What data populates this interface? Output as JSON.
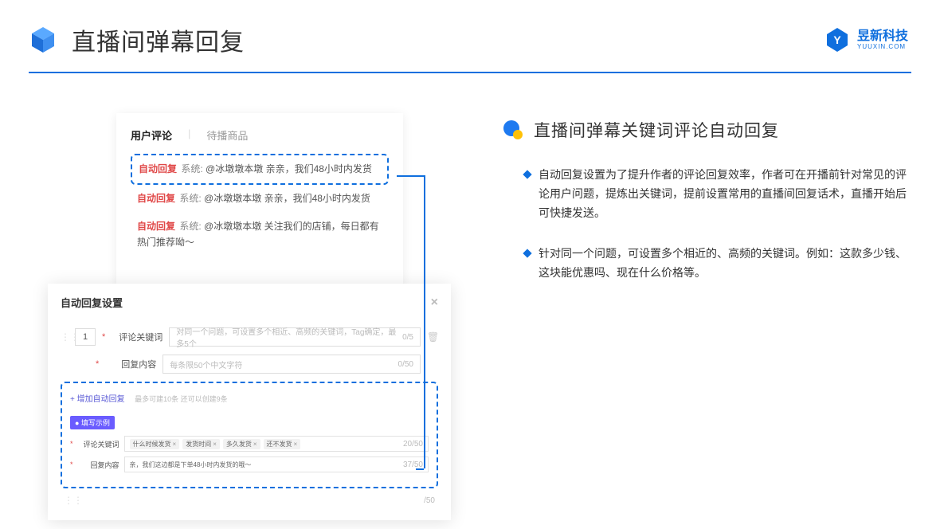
{
  "header": {
    "title": "直播间弹幕回复",
    "brand_name": "昱新科技",
    "brand_sub": "YUUXIN.COM"
  },
  "comment_card": {
    "tab_active": "用户评论",
    "tab_inactive": "待播商品",
    "highlight_prefix": "自动回复",
    "highlight_sys": "系统:",
    "highlight_text": "@冰墩墩本墩 亲亲，我们48小时内发货",
    "line2_prefix": "自动回复",
    "line2_sys": "系统:",
    "line2_text": "@冰墩墩本墩 亲亲，我们48小时内发货",
    "line3_prefix": "自动回复",
    "line3_sys": "系统:",
    "line3_text": "@冰墩墩本墩 关注我们的店铺，每日都有热门推荐呦～"
  },
  "settings": {
    "title": "自动回复设置",
    "num": "1",
    "kw_label": "评论关键词",
    "kw_placeholder": "对同一个问题，可设置多个相近、高频的关键词，Tag确定，最多5个",
    "kw_count": "0/5",
    "reply_label": "回复内容",
    "reply_placeholder": "每条限50个中文字符",
    "reply_count": "0/50",
    "add_text": "+ 增加自动回复",
    "add_hint": "最多可建10条 还可以创建9条",
    "badge": "● 填写示例",
    "ex_kw_label": "评论关键词",
    "ex_tags": [
      "什么时候发货",
      "发货时间",
      "多久发货",
      "还不发货"
    ],
    "ex_kw_count": "20/50",
    "ex_reply_label": "回复内容",
    "ex_reply_text": "亲，我们这边都是下单48小时内发货的哦～",
    "ex_reply_count": "37/50",
    "bottom_count": "/50"
  },
  "right": {
    "title": "直播间弹幕关键词评论自动回复",
    "b1": "自动回复设置为了提升作者的评论回复效率，作者可在开播前针对常见的评论用户问题，提炼出关键词，提前设置常用的直播间回复话术，直播开始后可快捷发送。",
    "b2": "针对同一个问题，可设置多个相近的、高频的关键词。例如：这款多少钱、这块能优惠吗、现在什么价格等。"
  }
}
